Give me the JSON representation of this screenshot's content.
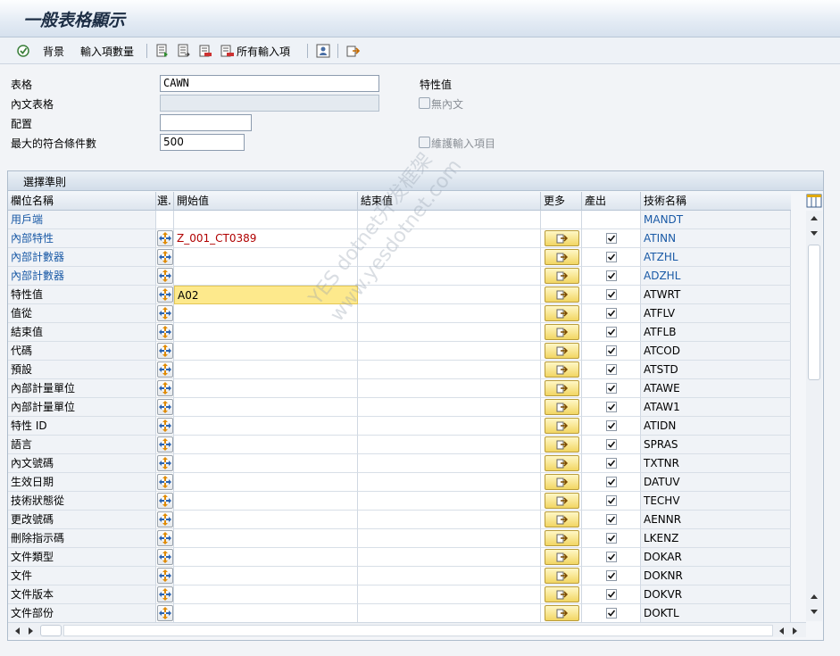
{
  "window": {
    "title": "一般表格顯示"
  },
  "toolbar": {
    "background_label": "背景",
    "entry_count_label": "輸入項數量",
    "all_entries_label": "所有輸入項"
  },
  "form": {
    "table_label": "表格",
    "table_value": "CAWN",
    "text_table_label": "內文表格",
    "text_table_value": "",
    "config_label": "配置",
    "config_value": "",
    "max_hits_label": "最大的符合條件數",
    "max_hits_value": "500",
    "char_value_label": "特性值",
    "no_text_label": "無內文",
    "maintain_entries_label": "維護輸入項目"
  },
  "group": {
    "title": "選擇準則"
  },
  "columns": {
    "field_name": "欄位名稱",
    "sel": "選.",
    "start": "開始值",
    "end": "結束值",
    "more": "更多",
    "output": "產出",
    "tech": "技術名稱"
  },
  "rows": [
    {
      "field": "用戶端",
      "start": "",
      "tech": "MANDT",
      "blue": true,
      "has_sel": false,
      "has_more": false,
      "output": false
    },
    {
      "field": "內部特性",
      "start": "Z_001_CT0389",
      "tech": "ATINN",
      "blue": true,
      "has_sel": true,
      "has_more": true,
      "output": true
    },
    {
      "field": "內部計數器",
      "start": "",
      "tech": "ATZHL",
      "blue": true,
      "has_sel": true,
      "has_more": true,
      "output": true
    },
    {
      "field": "內部計數器",
      "start": "",
      "tech": "ADZHL",
      "blue": true,
      "has_sel": true,
      "has_more": true,
      "output": true
    },
    {
      "field": "特性值",
      "start": "A02",
      "tech": "ATWRT",
      "blue": false,
      "has_sel": true,
      "has_more": true,
      "output": true
    },
    {
      "field": "值從",
      "start": "",
      "tech": "ATFLV",
      "blue": false,
      "has_sel": true,
      "has_more": true,
      "output": true
    },
    {
      "field": "結束值",
      "start": "",
      "tech": "ATFLB",
      "blue": false,
      "has_sel": true,
      "has_more": true,
      "output": true
    },
    {
      "field": "代碼",
      "start": "",
      "tech": "ATCOD",
      "blue": false,
      "has_sel": true,
      "has_more": true,
      "output": true
    },
    {
      "field": "預設",
      "start": "",
      "tech": "ATSTD",
      "blue": false,
      "has_sel": true,
      "has_more": true,
      "output": true
    },
    {
      "field": "內部計量單位",
      "start": "",
      "tech": "ATAWE",
      "blue": false,
      "has_sel": true,
      "has_more": true,
      "output": true
    },
    {
      "field": "內部計量單位",
      "start": "",
      "tech": "ATAW1",
      "blue": false,
      "has_sel": true,
      "has_more": true,
      "output": true
    },
    {
      "field": "特性 ID",
      "start": "",
      "tech": "ATIDN",
      "blue": false,
      "has_sel": true,
      "has_more": true,
      "output": true
    },
    {
      "field": "語言",
      "start": "",
      "tech": "SPRAS",
      "blue": false,
      "has_sel": true,
      "has_more": true,
      "output": true
    },
    {
      "field": "內文號碼",
      "start": "",
      "tech": "TXTNR",
      "blue": false,
      "has_sel": true,
      "has_more": true,
      "output": true
    },
    {
      "field": "生效日期",
      "start": "",
      "tech": "DATUV",
      "blue": false,
      "has_sel": true,
      "has_more": true,
      "output": true
    },
    {
      "field": "技術狀態從",
      "start": "",
      "tech": "TECHV",
      "blue": false,
      "has_sel": true,
      "has_more": true,
      "output": true
    },
    {
      "field": "更改號碼",
      "start": "",
      "tech": "AENNR",
      "blue": false,
      "has_sel": true,
      "has_more": true,
      "output": true
    },
    {
      "field": "刪除指示碼",
      "start": "",
      "tech": "LKENZ",
      "blue": false,
      "has_sel": true,
      "has_more": true,
      "output": true
    },
    {
      "field": "文件類型",
      "start": "",
      "tech": "DOKAR",
      "blue": false,
      "has_sel": true,
      "has_more": true,
      "output": true
    },
    {
      "field": "文件",
      "start": "",
      "tech": "DOKNR",
      "blue": false,
      "has_sel": true,
      "has_more": true,
      "output": true
    },
    {
      "field": "文件版本",
      "start": "",
      "tech": "DOKVR",
      "blue": false,
      "has_sel": true,
      "has_more": true,
      "output": true
    },
    {
      "field": "文件部份",
      "start": "",
      "tech": "DOKTL",
      "blue": false,
      "has_sel": true,
      "has_more": true,
      "output": true
    }
  ],
  "watermark": {
    "line1": "YES dotnet开发框架",
    "line2": "www.yesdotnet.com"
  },
  "colors": {
    "accent_blue": "#1a5aa6",
    "value_red": "#b00000",
    "highlight": "#fde98c"
  }
}
